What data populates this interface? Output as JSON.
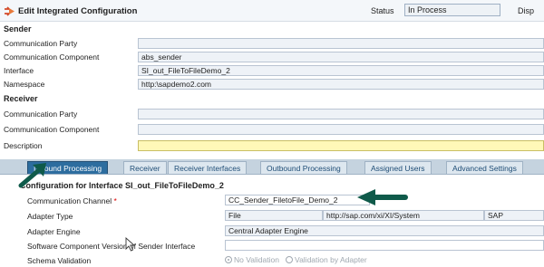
{
  "header": {
    "title": "Edit Integrated Configuration",
    "status_label": "Status",
    "status_value": "In Process",
    "display_label": "Disp"
  },
  "sender": {
    "heading": "Sender",
    "rows": [
      {
        "label": "Communication Party",
        "value": ""
      },
      {
        "label": "Communication Component",
        "value": "abs_sender"
      },
      {
        "label": "Interface",
        "value": "SI_out_FileToFileDemo_2"
      },
      {
        "label": "Namespace",
        "value": "http:\\sapdemo2.com"
      }
    ]
  },
  "receiver": {
    "heading": "Receiver",
    "rows": [
      {
        "label": "Communication Party",
        "value": ""
      },
      {
        "label": "Communication Component",
        "value": ""
      }
    ]
  },
  "description": {
    "label": "Description",
    "value": ""
  },
  "tabs": [
    {
      "label": "Inbound Processing",
      "active": true
    },
    {
      "label": "Receiver",
      "active": false
    },
    {
      "label": "Receiver Interfaces",
      "active": false
    },
    {
      "label": "Outbound Processing",
      "active": false
    },
    {
      "label": "Assigned Users",
      "active": false
    },
    {
      "label": "Advanced Settings",
      "active": false
    }
  ],
  "config": {
    "heading": "Configuration for Interface SI_out_FileToFileDemo_2",
    "channel_label": "Communication Channel",
    "channel_required": "*",
    "channel_value": "CC_Sender_FiletoFile_Demo_2",
    "adapter_type_label": "Adapter Type",
    "adapter_type_value": "File",
    "adapter_type_namespace": "http://sap.com/xi/XI/System",
    "adapter_type_extra": "SAP",
    "adapter_engine_label": "Adapter Engine",
    "adapter_engine_value": "Central Adapter Engine",
    "sw_version_label": "Software Component Version of Sender Interface",
    "sw_version_value": "",
    "schema_label": "Schema Validation",
    "schema_options": [
      "No Validation",
      "Validation by Adapter"
    ]
  },
  "colors": {
    "annotation_arrow": "#0f5a4a",
    "active_tab": "#2d6d9f"
  },
  "icons": [
    "edit-config-icon",
    "mouse-cursor-icon"
  ]
}
